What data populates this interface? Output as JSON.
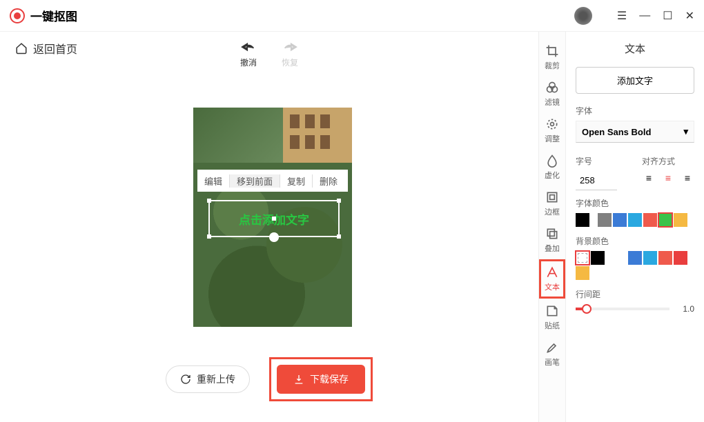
{
  "header": {
    "app_name": "一键抠图"
  },
  "nav": {
    "back_label": "返回首页"
  },
  "toolbar": {
    "undo": "撤消",
    "redo": "恢复"
  },
  "canvas": {
    "context_menu": {
      "edit": "编辑",
      "bring_front": "移到前面",
      "copy": "复制",
      "delete": "删除"
    },
    "text_placeholder": "点击添加文字"
  },
  "actions": {
    "reupload": "重新上传",
    "download": "下载保存"
  },
  "rail": [
    {
      "id": "crop",
      "label": "裁剪"
    },
    {
      "id": "filter",
      "label": "滤镜"
    },
    {
      "id": "adjust",
      "label": "调整"
    },
    {
      "id": "blur",
      "label": "虚化"
    },
    {
      "id": "border",
      "label": "边框"
    },
    {
      "id": "overlay",
      "label": "叠加"
    },
    {
      "id": "text",
      "label": "文本"
    },
    {
      "id": "sticker",
      "label": "贴纸"
    },
    {
      "id": "brush",
      "label": "画笔"
    }
  ],
  "panel": {
    "title": "文本",
    "add_text": "添加文字",
    "font_label": "字体",
    "font_value": "Open Sans Bold",
    "size_label": "字号",
    "size_value": "258",
    "align_label": "对齐方式",
    "font_color_label": "字体颜色",
    "bg_color_label": "背景颜色",
    "spacing_label": "行间距",
    "spacing_value": "1.0",
    "font_colors": [
      "#000000",
      "#808080",
      "#3b7bd6",
      "#2aa8e0",
      "#ef5a4c",
      "#3bc24a",
      "#f5b942"
    ],
    "font_color_selected": 5,
    "bg_colors": [
      "transparent",
      "#000000",
      "#ffffff",
      "#3b7bd6",
      "#2aa8e0",
      "#ef5a4c",
      "#e93e3e",
      "#f5b942"
    ],
    "bg_color_selected": 0
  }
}
